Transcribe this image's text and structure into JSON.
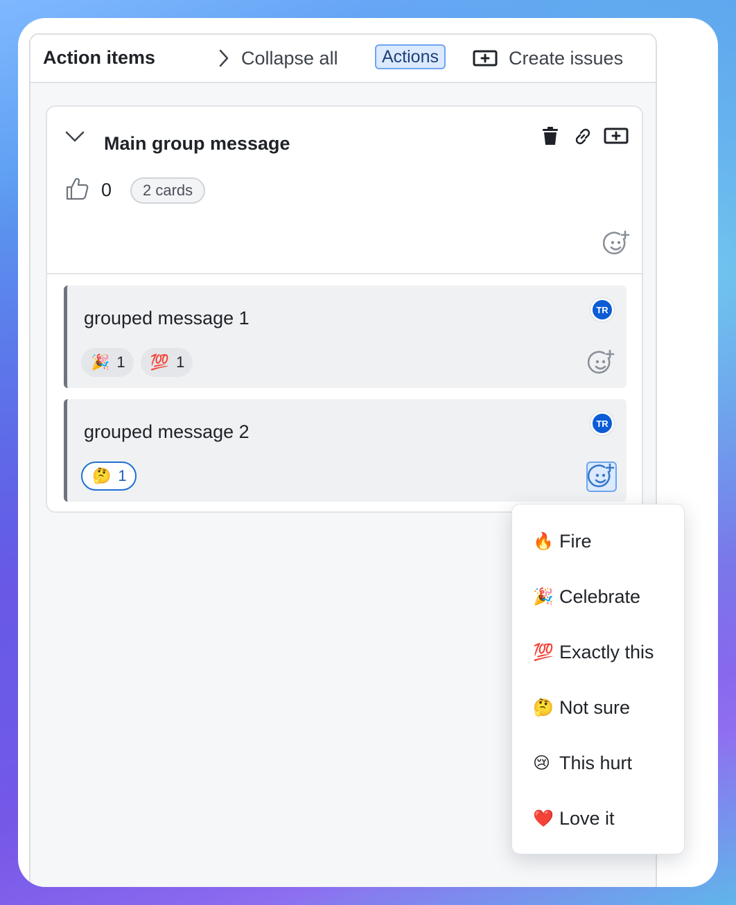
{
  "header": {
    "title": "Action items",
    "collapse_label": "Collapse all",
    "actions_label": "Actions",
    "create_label": "Create issues"
  },
  "group": {
    "title": "Main group message",
    "votes": "0",
    "cards_label": "2 cards"
  },
  "messages": [
    {
      "text": "grouped message 1",
      "avatar": "TR",
      "reactions": [
        {
          "emoji": "🎉",
          "count": "1"
        },
        {
          "emoji": "💯",
          "count": "1"
        }
      ]
    },
    {
      "text": "grouped message 2",
      "avatar": "TR",
      "reactions": [
        {
          "emoji": "🤔",
          "count": "1"
        }
      ]
    }
  ],
  "reaction_menu": [
    {
      "emoji": "🔥",
      "label": "Fire"
    },
    {
      "emoji": "🎉",
      "label": "Celebrate"
    },
    {
      "emoji": "💯",
      "label": "Exactly this"
    },
    {
      "emoji": "🤔",
      "label": "Not sure"
    },
    {
      "emoji": "😢",
      "label": "This hurt"
    },
    {
      "emoji": "❤️",
      "label": "Love it"
    }
  ],
  "colors": {
    "accent": "#1e6fd0",
    "avatar_bg": "#0b5cd5",
    "active_bg": "#dbeafe"
  }
}
